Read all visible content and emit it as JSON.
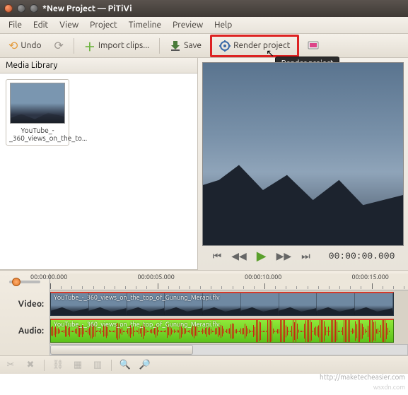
{
  "window": {
    "title": "*New Project — PiTiVi"
  },
  "menu": {
    "file": "File",
    "edit": "Edit",
    "view": "View",
    "project": "Project",
    "timeline": "Timeline",
    "preview": "Preview",
    "help": "Help"
  },
  "toolbar": {
    "undo": "Undo",
    "import": "Import clips...",
    "save": "Save",
    "render": "Render project",
    "render_tooltip": "Render project"
  },
  "library": {
    "header": "Media Library",
    "clips": [
      {
        "name": "YouTube_-_360_views_on_the_to..."
      }
    ]
  },
  "preview": {
    "timecode": "00:00:00.000"
  },
  "timeline": {
    "ruler": [
      "00:00:00.000",
      "00:00:05.000",
      "00:00:10.000",
      "00:00:15.000"
    ],
    "video_label": "Video:",
    "audio_label": "Audio:",
    "clip_name": "YouTube_-_360_views_on_the_top_of_Gunung_Merapi.flv"
  },
  "watermark": "http://maketecheasier.com",
  "watermark2": "wsxdn.com"
}
